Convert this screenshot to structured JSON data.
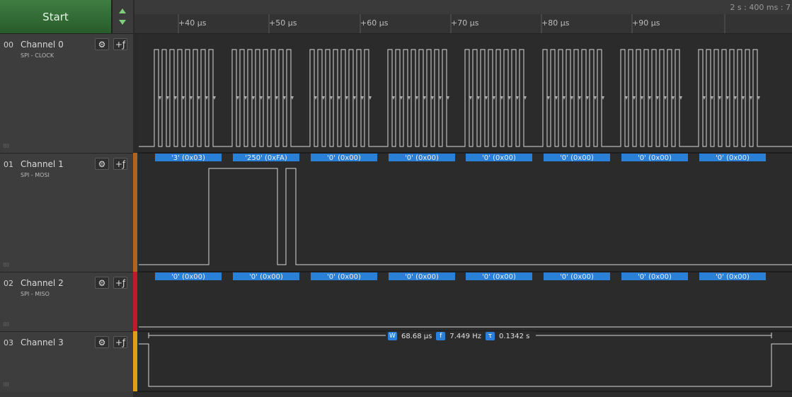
{
  "toolbar": {
    "start_label": "Start"
  },
  "timeline": {
    "timestamp": "2 s : 400 ms : 7",
    "ticks": [
      "+40 µs",
      "+50 µs",
      "+60 µs",
      "+70 µs",
      "+80 µs",
      "+90 µs"
    ]
  },
  "channels": [
    {
      "num": "00",
      "name": "Channel 0",
      "sub": "SPI - CLOCK",
      "color": "#3d3d3d"
    },
    {
      "num": "01",
      "name": "Channel 1",
      "sub": "SPI - MOSI",
      "color": "#b0651c"
    },
    {
      "num": "02",
      "name": "Channel 2",
      "sub": "SPI - MISO",
      "color": "#c2182a"
    },
    {
      "num": "03",
      "name": "Channel 3",
      "sub": "",
      "color": "#e0a014"
    }
  ],
  "icons": {
    "settings": "gear-icon",
    "add_analyzer": "plus-function-icon"
  },
  "mosi_bytes": [
    "'3' (0x03)",
    "'250' (0xFA)",
    "'0' (0x00)",
    "'0' (0x00)",
    "'0' (0x00)",
    "'0' (0x00)",
    "'0' (0x00)",
    "'0' (0x00)"
  ],
  "miso_bytes": [
    "'0' (0x00)",
    "'0' (0x00)",
    "'0' (0x00)",
    "'0' (0x00)",
    "'0' (0x00)",
    "'0' (0x00)",
    "'0' (0x00)",
    "'0' (0x00)"
  ],
  "measurement": {
    "w_label": "W",
    "width": "68.68 µs",
    "f_label": "f",
    "frequency": "7.449 Hz",
    "t_label": "τ",
    "period": "0.1342 s"
  },
  "colors": {
    "accent": "#2a7fd6",
    "trace": "#d8d8d8",
    "start": "#2f6a33"
  }
}
